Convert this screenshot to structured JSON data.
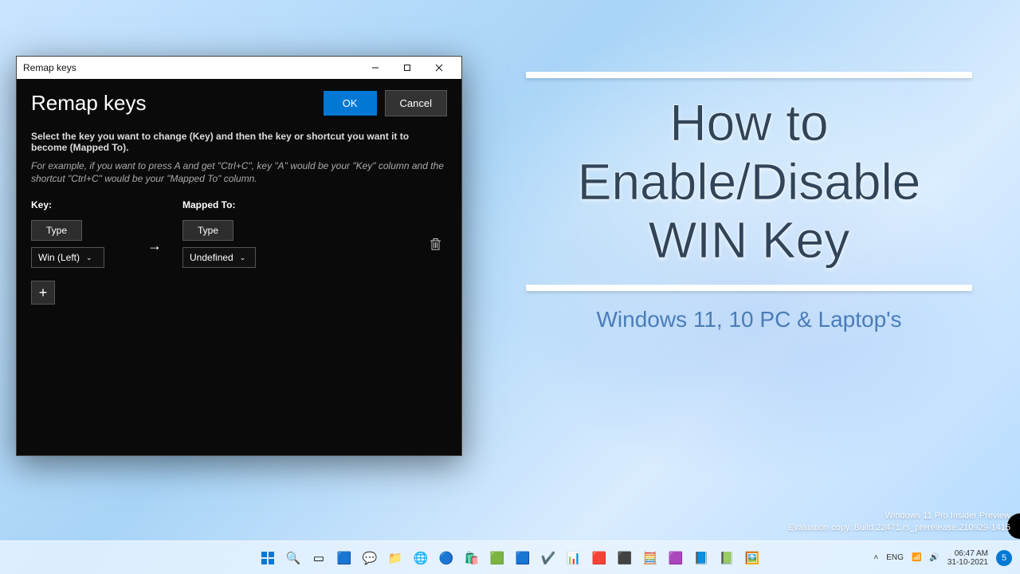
{
  "dialog": {
    "window_title": "Remap keys",
    "title": "Remap keys",
    "ok": "OK",
    "cancel": "Cancel",
    "instruction": "Select the key you want to change (Key) and then the key or shortcut you want it to become (Mapped To).",
    "example": "For example, if you want to press A and get \"Ctrl+C\", key \"A\" would be your \"Key\" column and the shortcut \"Ctrl+C\" would be your \"Mapped To\" column.",
    "key_label": "Key:",
    "mapped_label": "Mapped To:",
    "type_btn": "Type",
    "key_value": "Win (Left)",
    "mapped_value": "Undefined"
  },
  "promo": {
    "title_l1": "How to",
    "title_l2": "Enable/Disable",
    "title_l3": "WIN Key",
    "subtitle": "Windows 11, 10 PC & Laptop's"
  },
  "watermark": {
    "l1": "Windows 11 Pro Insider Preview",
    "l2": "Evaluation copy. Build 22471.rs_prerelease.210929-1415"
  },
  "taskbar": {
    "lang": "ENG",
    "time": "06:47 AM",
    "date": "31-10-2021",
    "notif": "5"
  }
}
